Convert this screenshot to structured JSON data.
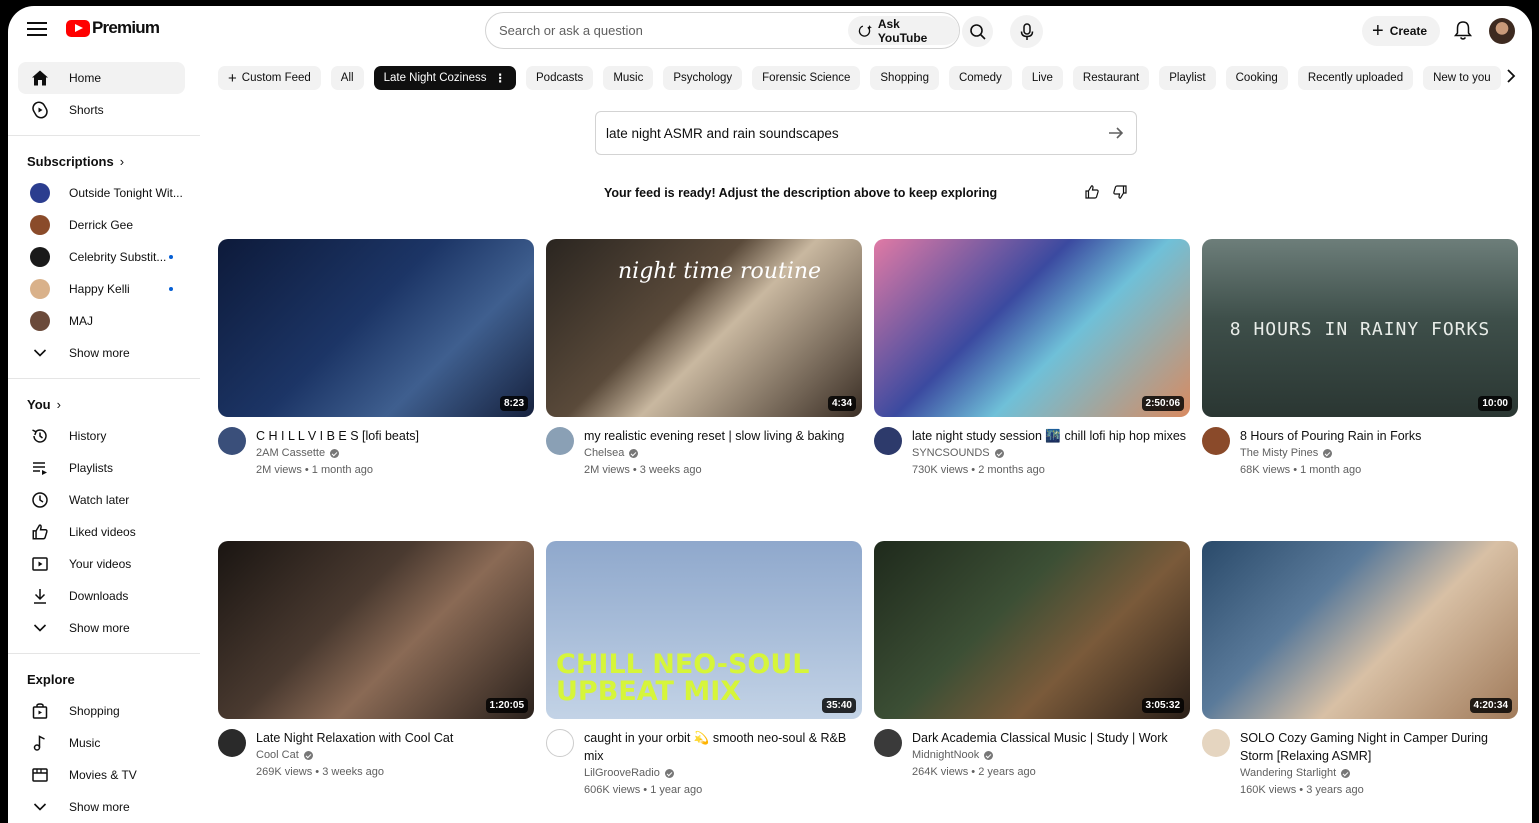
{
  "header": {
    "logo_text": "Premium",
    "search_placeholder": "Search or ask a question",
    "ask_label": "Ask YouTube",
    "create_label": "Create"
  },
  "sidebar": {
    "main": [
      {
        "label": "Home",
        "icon": "home-icon",
        "active": true
      },
      {
        "label": "Shorts",
        "icon": "shorts-icon"
      }
    ],
    "subscriptions_title": "Subscriptions",
    "subscriptions": [
      {
        "label": "Outside Tonight Wit...",
        "color": "#2b3d8f",
        "new": false
      },
      {
        "label": "Derrick Gee",
        "color": "#8a4b2a",
        "new": false
      },
      {
        "label": "Celebrity Substit...",
        "color": "#1a1a1a",
        "new": true
      },
      {
        "label": "Happy Kelli",
        "color": "#d9b18a",
        "new": true
      },
      {
        "label": "MAJ",
        "color": "#6b4a3a",
        "new": false
      }
    ],
    "subs_show_more": "Show more",
    "you_title": "You",
    "you_items": [
      {
        "label": "History",
        "icon": "history-icon"
      },
      {
        "label": "Playlists",
        "icon": "playlists-icon"
      },
      {
        "label": "Watch later",
        "icon": "clock-icon"
      },
      {
        "label": "Liked videos",
        "icon": "thumbs-up-icon"
      },
      {
        "label": "Your videos",
        "icon": "play-square-icon"
      },
      {
        "label": "Downloads",
        "icon": "download-icon"
      }
    ],
    "you_show_more": "Show more",
    "explore_title": "Explore",
    "explore_items": [
      {
        "label": "Shopping",
        "icon": "shopping-bag-icon"
      },
      {
        "label": "Music",
        "icon": "music-note-icon"
      },
      {
        "label": "Movies & TV",
        "icon": "film-icon"
      }
    ],
    "explore_show_more": "Show more"
  },
  "chips": [
    {
      "label": "Custom Feed",
      "plus": true
    },
    {
      "label": "All"
    },
    {
      "label": "Late Night Coziness",
      "active": true
    },
    {
      "label": "Podcasts"
    },
    {
      "label": "Music"
    },
    {
      "label": "Psychology"
    },
    {
      "label": "Forensic Science"
    },
    {
      "label": "Shopping"
    },
    {
      "label": "Comedy"
    },
    {
      "label": "Live"
    },
    {
      "label": "Restaurant"
    },
    {
      "label": "Playlist"
    },
    {
      "label": "Cooking"
    },
    {
      "label": "Recently uploaded"
    },
    {
      "label": "New to you"
    }
  ],
  "feed": {
    "description_value": "late night ASMR and rain soundscapes",
    "ready_message": "Your feed is ready! Adjust the description above to keep exploring"
  },
  "videos": [
    {
      "title": "C H I L L  V I B E S [lofi beats]",
      "channel": "2AM Cassette",
      "verified": true,
      "stats": "2M views • 1 month ago",
      "duration": "8:23",
      "bg": "linear-gradient(135deg,#0d1a3a 0%,#1c3566 45%,#3f5f8f 70%,#16213d 100%)",
      "avatar": "#3a4f7a"
    },
    {
      "title": "my realistic evening reset | slow living & baking",
      "channel": "Chelsea",
      "verified": true,
      "stats": "2M views • 3 weeks ago",
      "duration": "4:34",
      "bg": "linear-gradient(135deg,#2a2520 0%,#5a4a3a 40%,#c9b8a0 55%,#3a2e25 100%)",
      "avatar": "#8aa0b5",
      "overlay": "night time routine"
    },
    {
      "title": "late night study session 🌃 chill lofi hip hop mixes",
      "channel": "SYNCSOUNDS",
      "verified": true,
      "stats": "730K views • 2 months ago",
      "duration": "2:50:06",
      "bg": "linear-gradient(135deg,#e07aa5 0%,#3b4aa0 40%,#6fc0d8 60%,#d98a60 100%)",
      "avatar": "#2d3a6b"
    },
    {
      "title": "8 Hours of Pouring Rain in Forks",
      "channel": "The Misty Pines",
      "verified": true,
      "stats": "68K views • 1 month ago",
      "duration": "10:00",
      "bg": "linear-gradient(180deg,#6d7e7a 0%,#3e4f4a 45%,#2a3632 100%)",
      "avatar": "#8a4a2a",
      "overlay": "8 HOURS IN RAINY FORKS"
    },
    {
      "title": "Late Night Relaxation with Cool Cat",
      "channel": "Cool Cat",
      "verified": true,
      "stats": "269K views • 3 weeks ago",
      "duration": "1:20:05",
      "bg": "linear-gradient(135deg,#1a1512 0%,#4a3a30 40%,#8a6a55 60%,#2a211c 100%)",
      "avatar": "#2a2a2a"
    },
    {
      "title": "caught in your orbit 💫 smooth neo-soul & R&B mix",
      "channel": "LilGrooveRadio",
      "verified": true,
      "stats": "606K views • 1 year ago",
      "duration": "35:40",
      "bg": "linear-gradient(180deg,#8fa8cc 0%,#a8bdd9 50%,#c3d3e6 100%)",
      "avatar": "#ffffff",
      "overlay": "CHILL NEO-SOUL UPBEAT MIX"
    },
    {
      "title": "Dark Academia Classical Music | Study | Work",
      "channel": "MidnightNook",
      "verified": true,
      "stats": "264K views • 2 years ago",
      "duration": "3:05:32",
      "bg": "linear-gradient(135deg,#1f2a1c 0%,#3c4f35 40%,#7a5a3a 65%,#2a1f18 100%)",
      "avatar": "#3a3a3a"
    },
    {
      "title": "SOLO Cozy Gaming Night in Camper During Storm [Relaxing ASMR]",
      "channel": "Wandering Starlight",
      "verified": true,
      "stats": "160K views • 3 years ago",
      "duration": "4:20:34",
      "bg": "linear-gradient(135deg,#2a4a6a 0%,#5a7a9a 35%,#d8c0a5 60%,#a07a5a 100%)",
      "avatar": "#e5d5c0"
    }
  ]
}
